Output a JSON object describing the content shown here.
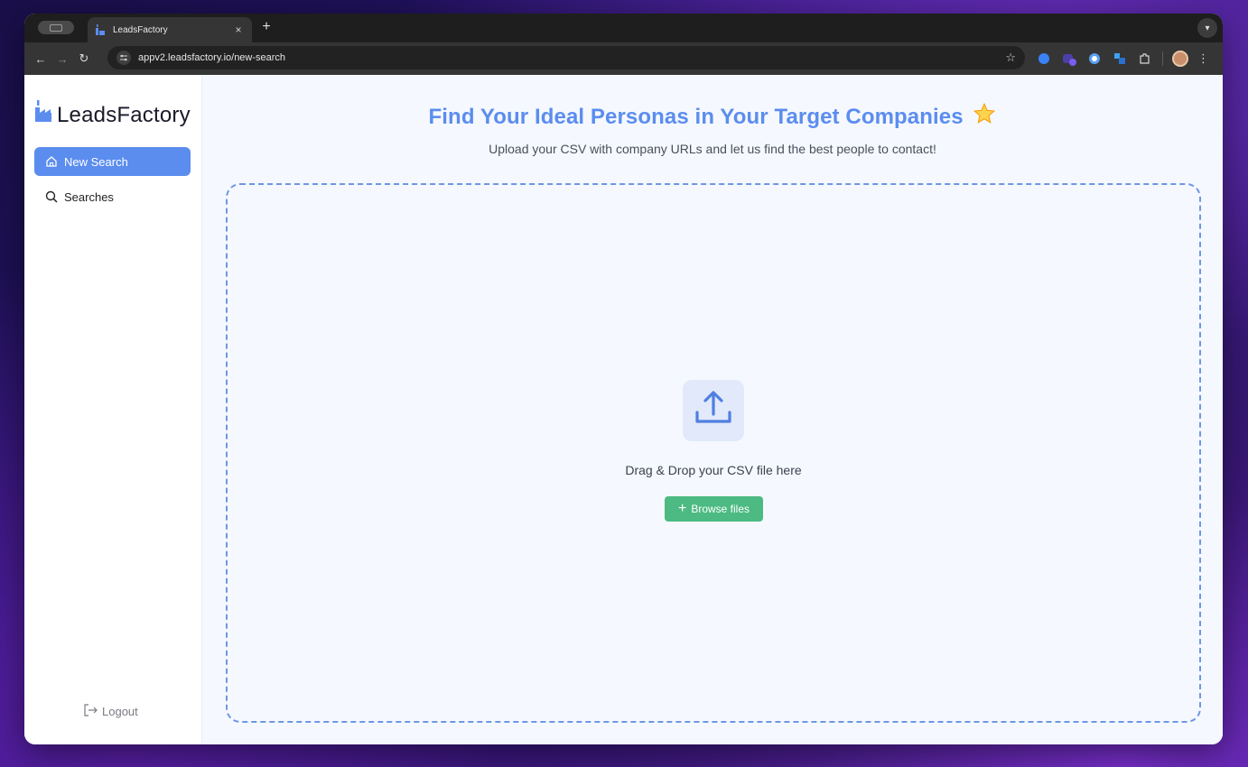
{
  "browser": {
    "tab_title": "LeadsFactory",
    "tab_close": "×",
    "new_tab": "+",
    "url": "appv2.leadsfactory.io/new-search"
  },
  "sidebar": {
    "logo_text": "LeadsFactory",
    "items": [
      {
        "label": "New Search",
        "icon": "home-icon",
        "active": true
      },
      {
        "label": "Searches",
        "icon": "search-icon",
        "active": false
      }
    ],
    "logout_label": "Logout"
  },
  "main": {
    "title": "Find Your Ideal Personas in Your Target Companies",
    "subtitle": "Upload your CSV with company URLs and let us find the best people to contact!",
    "dropzone": {
      "text": "Drag & Drop your CSV file here",
      "browse_label": "Browse files"
    }
  },
  "colors": {
    "accent": "#5b8def",
    "success": "#4cba82",
    "background": "#f5f8fe"
  }
}
